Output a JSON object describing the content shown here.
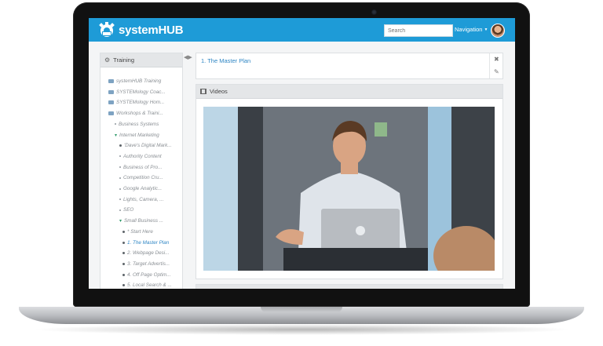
{
  "app": {
    "logo_text": "systemHUB",
    "search_placeholder": "Search",
    "navigation_label": "Navigation"
  },
  "sidebar": {
    "title": "Training",
    "items": [
      {
        "label": "systemHUB Training",
        "level": 0,
        "marker": "folder"
      },
      {
        "label": "SYSTEMology Coac...",
        "level": 0,
        "marker": "folder"
      },
      {
        "label": "SYSTEMology Hom...",
        "level": 0,
        "marker": "folder"
      },
      {
        "label": "Workshops & Traini...",
        "level": 0,
        "marker": "folder"
      },
      {
        "label": "Business Systems",
        "level": 1,
        "marker": "bullet"
      },
      {
        "label": "Internet Marketing",
        "level": 1,
        "marker": "open"
      },
      {
        "label": "'Dave's Digital Mark...",
        "level": 2,
        "marker": "dot-dark"
      },
      {
        "label": "Authority Content",
        "level": 2,
        "marker": "bullet"
      },
      {
        "label": "Business of Pro...",
        "level": 2,
        "marker": "bullet"
      },
      {
        "label": "Competition Cru...",
        "level": 2,
        "marker": "bullet"
      },
      {
        "label": "Google Analytic...",
        "level": 2,
        "marker": "bullet"
      },
      {
        "label": "Lights, Camera, ...",
        "level": 2,
        "marker": "bullet"
      },
      {
        "label": "SEO",
        "level": 2,
        "marker": "bullet"
      },
      {
        "label": "Small Business ...",
        "level": 2,
        "marker": "open"
      },
      {
        "label": "* Start Here",
        "level": 3,
        "marker": "dot-dark"
      },
      {
        "label": "1. The Master Plan",
        "level": 3,
        "marker": "dot-dark",
        "active": true
      },
      {
        "label": "2. Webpage Desi...",
        "level": 3,
        "marker": "dot-dark"
      },
      {
        "label": "3. Target Advertis...",
        "level": 3,
        "marker": "dot-dark"
      },
      {
        "label": "4. Off Page Optim...",
        "level": 3,
        "marker": "dot-dark"
      },
      {
        "label": "5. Local Search & ...",
        "level": 3,
        "marker": "dot-dark"
      }
    ]
  },
  "content": {
    "breadcrumb": "1. The Master Plan",
    "videos_title": "Videos"
  },
  "colors": {
    "brand": "#1e9bd7",
    "link": "#2f86c4"
  }
}
